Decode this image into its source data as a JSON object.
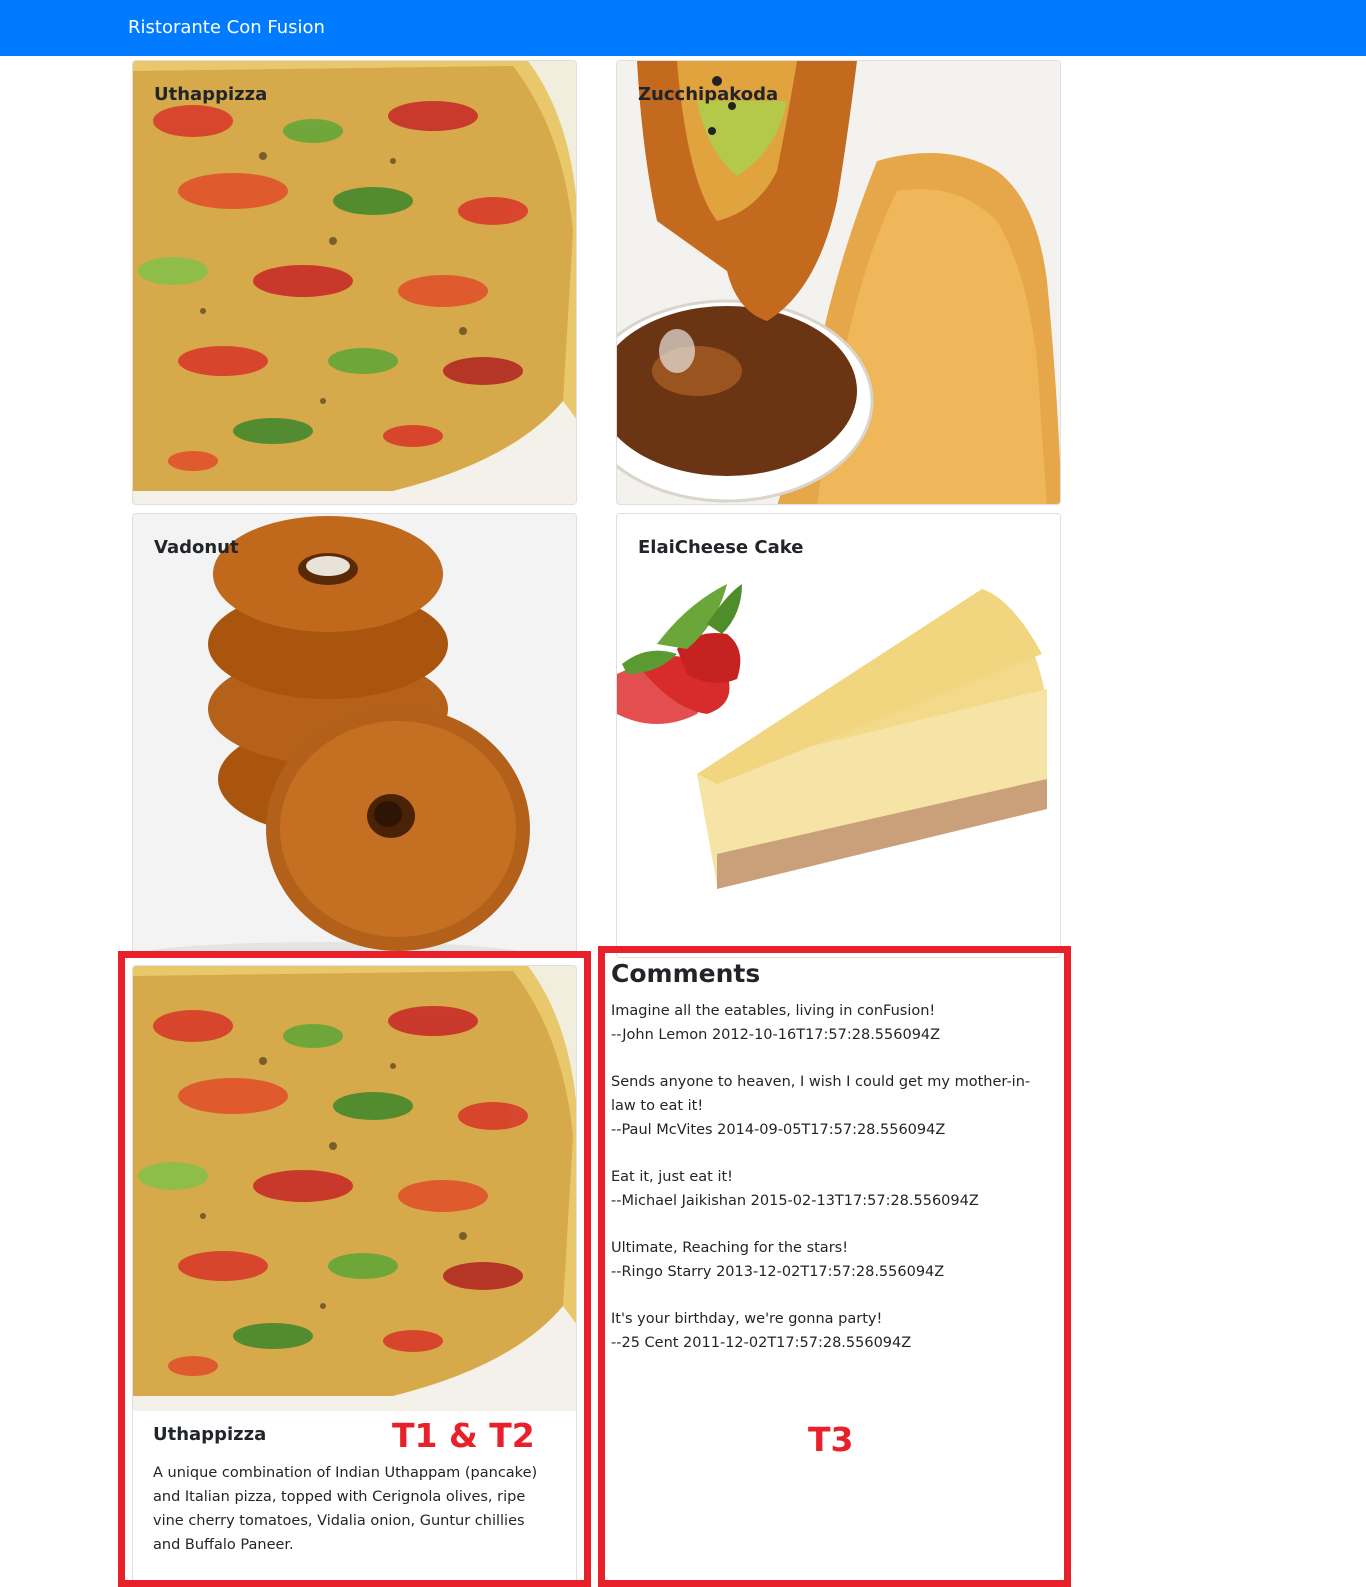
{
  "navbar": {
    "brand": "Ristorante Con Fusion"
  },
  "menu": {
    "dishes": [
      {
        "name": "Uthappizza"
      },
      {
        "name": "Zucchipakoda"
      },
      {
        "name": "Vadonut"
      },
      {
        "name": "ElaiCheese Cake"
      }
    ]
  },
  "dish_detail": {
    "name": "Uthappizza",
    "description": "A unique combination of Indian Uthappam (pancake) and Italian pizza, topped with Cerignola olives, ripe vine cherry tomatoes, Vidalia onion, Guntur chillies and Buffalo Paneer."
  },
  "comments": {
    "heading": "Comments",
    "items": [
      {
        "text": "Imagine all the eatables, living in conFusion!",
        "byline": "--John Lemon 2012-10-16T17:57:28.556094Z"
      },
      {
        "text": "Sends anyone to heaven, I wish I could get my mother-in-law to eat it!",
        "byline": "--Paul McVites 2014-09-05T17:57:28.556094Z"
      },
      {
        "text": "Eat it, just eat it!",
        "byline": "--Michael Jaikishan 2015-02-13T17:57:28.556094Z"
      },
      {
        "text": "Ultimate, Reaching for the stars!",
        "byline": "--Ringo Starry 2013-12-02T17:57:28.556094Z"
      },
      {
        "text": "It's your birthday, we're gonna party!",
        "byline": "--25 Cent 2011-12-02T17:57:28.556094Z"
      }
    ]
  },
  "annotations": {
    "left_label": "T1 & T2",
    "right_label": "T3"
  },
  "colors": {
    "navbar": "#007bff",
    "annotation": "#e8202a"
  }
}
